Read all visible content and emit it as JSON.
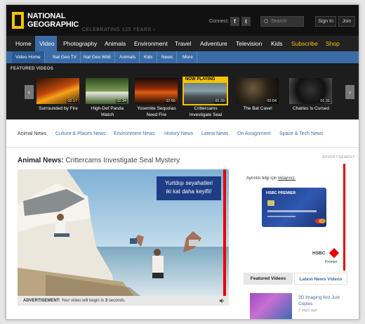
{
  "brand": {
    "logo_line1": "NATIONAL",
    "logo_line2": "GEOGRAPHIC",
    "tagline": "CELEBRATING 125 YEARS ›"
  },
  "topbar": {
    "connect_label": "Connect:",
    "social": [
      "f",
      "t"
    ],
    "search_placeholder": "Search",
    "signin": "Sign In",
    "join": "Join"
  },
  "main_nav": [
    "Home",
    "Video",
    "Photography",
    "Animals",
    "Environment",
    "Travel",
    "Adventure",
    "Television",
    "Kids",
    "Subscribe",
    "Shop"
  ],
  "sub_nav": [
    "Video Home",
    "Nat Geo TV",
    "Nat Geo Wild",
    "Animals",
    "Kids",
    "News",
    "More"
  ],
  "featured": {
    "heading": "FEATURED VIDEOS",
    "now_playing": "NOW PLAYING",
    "items": [
      {
        "title_line1": "Surrounded by Fire",
        "title_line2": "",
        "duration": "02:17"
      },
      {
        "title_line1": "High-Def Panda",
        "title_line2": "Watch",
        "duration": "02:34"
      },
      {
        "title_line1": "Yosemite Sequoias",
        "title_line2": "Need Fire",
        "duration": "02:55"
      },
      {
        "title_line1": "Crittercams",
        "title_line2": "Investigate Seal",
        "duration": "05:39"
      },
      {
        "title_line1": "The Bat Cave!",
        "title_line2": "",
        "duration": "03:04"
      },
      {
        "title_line1": "Charles Is Cursed",
        "title_line2": "",
        "duration": "01:31"
      }
    ]
  },
  "tabs": [
    "Animal News",
    "Culture & Places News",
    "Environment News",
    "History News",
    "Latest News",
    "On Assignment",
    "Space & Tech News"
  ],
  "article": {
    "category": "Animal News:",
    "title": " Crittercams Investigate Seal Mystery"
  },
  "video_ad": {
    "overlay_line1": "Yurtdışı seyahatleri",
    "overlay_line2": "iki kat daha keyifli!",
    "ad_label": "ADVERTISEMENT:",
    "ad_text": " Your video will begin in ",
    "countdown": "3",
    "ad_suffix": " seconds."
  },
  "side_ad": {
    "label": "ADVERTISEMENT",
    "info_text": "Ayrıntılı bilgi için ",
    "info_link": "tıklayınız.",
    "card_brand": "HSBC",
    "card_tier": "PREMIER",
    "bank_name": "HSBC",
    "bank_sub": "Premier"
  },
  "side_tabs": {
    "featured": "Featured Videos",
    "latest": "Latest News Videos"
  },
  "side_list": [
    {
      "title": "3D Imaging Not Just Copies",
      "date": "2 days ago"
    }
  ],
  "colors": {
    "nav_blue": "#3c6ca8",
    "yellow": "#f5c400",
    "red": "#e00000"
  }
}
